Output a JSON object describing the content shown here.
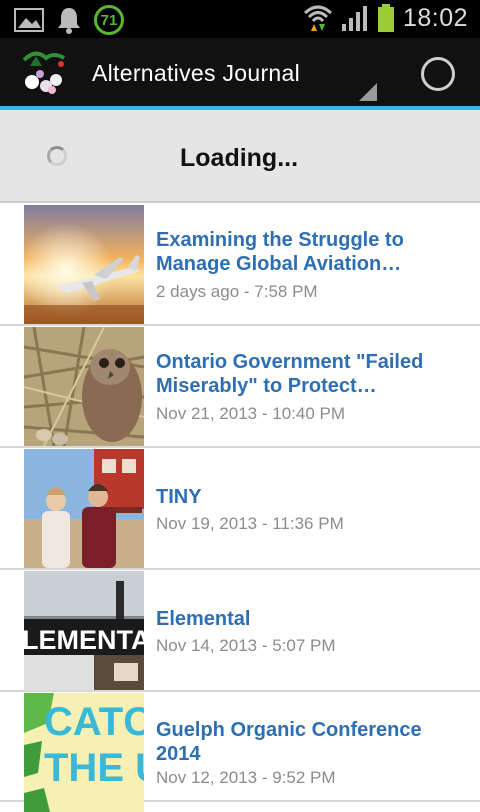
{
  "status_bar": {
    "time": "18:02",
    "notification_count": "71",
    "icons": [
      "image-icon",
      "bell-icon",
      "counter-badge-icon",
      "wifi-icon",
      "signal-icon",
      "battery-icon"
    ]
  },
  "app_bar": {
    "title": "Alternatives Journal",
    "accent_color": "#33b5e5"
  },
  "loading": {
    "text": "Loading..."
  },
  "articles": [
    {
      "title": "Examining the Struggle to Manage Global Aviation…",
      "date": "2 days ago - 7:58 PM"
    },
    {
      "title": "Ontario Government \"Failed Miserably\" to Protect…",
      "date": "Nov 21, 2013 - 10:40 PM"
    },
    {
      "title": "TINY",
      "date": "Nov 19, 2013 - 11:36 PM"
    },
    {
      "title": "Elemental",
      "date": "Nov 14, 2013 - 5:07 PM",
      "thumb_text": "LEMENTA"
    },
    {
      "title": "Guelph Organic Conference 2014",
      "date": "Nov 12, 2013 - 9:52 PM",
      "thumb_text_1": "CATC",
      "thumb_text_2": "THE U"
    }
  ]
}
